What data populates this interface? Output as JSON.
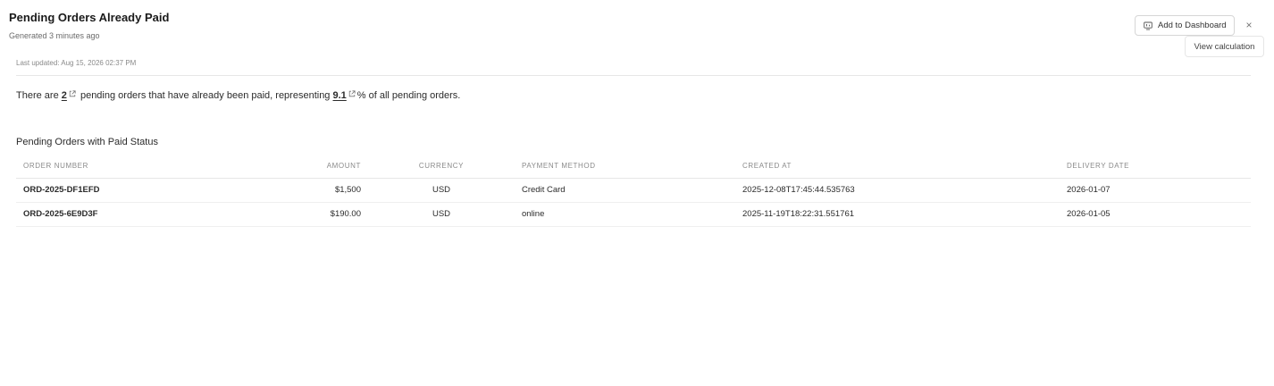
{
  "header": {
    "title": "Pending Orders Already Paid",
    "generated": "Generated 3 minutes ago",
    "add_to_dashboard_label": "Add to Dashboard",
    "close_label": "×",
    "view_calculation_label": "View calculation"
  },
  "last_updated": "Last updated: Aug 15, 2026 02:37 PM",
  "summary": {
    "prefix": "There are",
    "count": "2",
    "middle": "pending orders that have already been paid, representing",
    "percent": "9.1",
    "suffix": "% of all pending orders."
  },
  "table": {
    "title": "Pending Orders with Paid Status",
    "columns": [
      "ORDER NUMBER",
      "AMOUNT",
      "CURRENCY",
      "PAYMENT METHOD",
      "CREATED AT",
      "DELIVERY DATE"
    ],
    "rows": [
      {
        "order_number": "ORD-2025-DF1EFD",
        "amount": "$1,500",
        "currency": "USD",
        "payment_method": "Credit Card",
        "created_at": "2025-12-08T17:45:44.535763",
        "delivery_date": "2026-01-07"
      },
      {
        "order_number": "ORD-2025-6E9D3F",
        "amount": "$190.00",
        "currency": "USD",
        "payment_method": "online",
        "created_at": "2025-11-19T18:22:31.551761",
        "delivery_date": "2026-01-05"
      }
    ]
  },
  "icons": {
    "dashboard": "dashboard-icon",
    "external_link": "external-link-icon",
    "close": "close-icon"
  }
}
